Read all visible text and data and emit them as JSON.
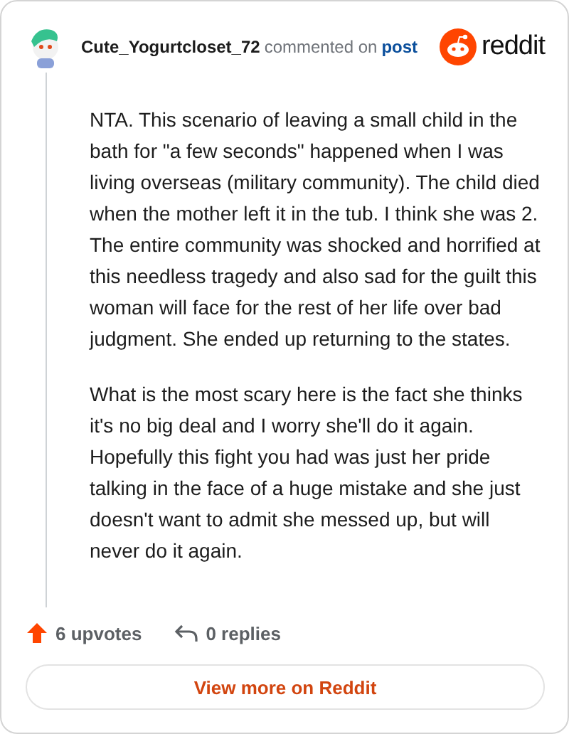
{
  "header": {
    "username": "Cute_Yogurtcloset_72",
    "action": "commented on",
    "link": "post",
    "brand": "reddit"
  },
  "paragraphs": [
    "NTA. This scenario of leaving a small child in the bath for \"a few seconds\" happened when I was living overseas (military community). The child died when the mother left it in the tub. I think she was 2. The entire community was shocked and horrified at this needless tragedy and also sad for the guilt this woman will face for the rest of her life over bad judgment. She ended up returning to the states.",
    "What is the most scary here is the fact she thinks it's no big deal and I worry she'll do it again. Hopefully this fight you had was just her pride talking in the face of a huge mistake and she just doesn't want to admit she messed up, but will never do it again."
  ],
  "stats": {
    "upvotes": "6 upvotes",
    "replies": "0 replies"
  },
  "button": "View more on Reddit"
}
